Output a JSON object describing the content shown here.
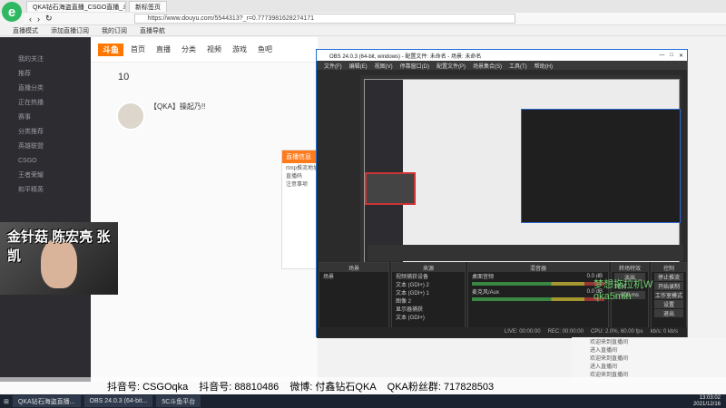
{
  "browser": {
    "tabs": [
      "QKA钻石海盗直播_CSGO直播_斗...",
      "新标签页"
    ],
    "url": "https://www.douyu.com/5544313?_r=0.7773981628274171",
    "bookmarks": [
      "直播模式",
      "添加直播订阅",
      "我的订阅",
      "直播导航"
    ]
  },
  "site": {
    "logo": "斗鱼",
    "nav": [
      "首页",
      "直播",
      "分类",
      "视频",
      "游戏",
      "鱼吧"
    ],
    "sidebar": [
      "我的关注",
      "推荐",
      "直播分类",
      "正在热播",
      "赛事",
      "分类推荐",
      "英雄联盟",
      "CSGO",
      "王者荣耀",
      "和平精英"
    ],
    "level": "10",
    "streamer_title": "【QKA】操起乃!!",
    "popup_title": "直播信息",
    "popup_lines": [
      "rtmp推流地址",
      "直播码",
      "注意事项"
    ],
    "cam_text": "金针菇 陈宏亮 张凯"
  },
  "obs": {
    "title": "OBS 24.0.3 (64-bit, windows) - 配置文件: 未命名 - 场景: 未命名",
    "menu": [
      "文件(F)",
      "编辑(E)",
      "视图(V)",
      "停靠窗口(D)",
      "配置文件(P)",
      "场景集合(S)",
      "工具(T)",
      "帮助(H)"
    ],
    "docks": {
      "scenes": {
        "title": "场景",
        "items": [
          "场景"
        ]
      },
      "sources": {
        "title": "来源",
        "items": [
          "视频捕获设备",
          "文本 (GDI+) 2",
          "文本 (GDI+) 1",
          "图像 2",
          "显示器捕获",
          "文本 (GDI+)"
        ]
      },
      "mixer": {
        "title": "混音器",
        "tracks": [
          "桌面音频",
          "麦克风/Aux"
        ],
        "db": [
          "0.0 dB",
          "0.0 dB"
        ]
      },
      "transitions": {
        "title": "转场特效",
        "mode": "淡出",
        "duration_label": "时长",
        "duration": "300 ms"
      },
      "controls": {
        "title": "控制",
        "buttons": [
          "停止推流",
          "开始录制",
          "工作室模式",
          "设置",
          "退出"
        ]
      }
    },
    "status": [
      "LIVE: 00:00:00",
      "REC: 00:00:00",
      "CPU: 2.0%, 60.00 fps",
      "kb/s: 0 kb/s"
    ],
    "watermark": "梦想拖拉机W  qka5min"
  },
  "chat": [
    "欢迎来到直播间",
    "进入直播间",
    "欢迎来到直播间",
    "进入直播间",
    "欢迎来到直播间"
  ],
  "overlay": [
    "抖音号: CSGOqka",
    "抖音号: 88810486",
    "微博: 付鑫钻石QKA",
    "QKA粉丝群: 717828503"
  ],
  "taskbar": {
    "apps": [
      "QKA钻石海盗直播...",
      "OBS 24.0.3 (64-bit...",
      "5C斗鱼平台"
    ],
    "time": "13:03:02",
    "date": "2021/12/16"
  }
}
